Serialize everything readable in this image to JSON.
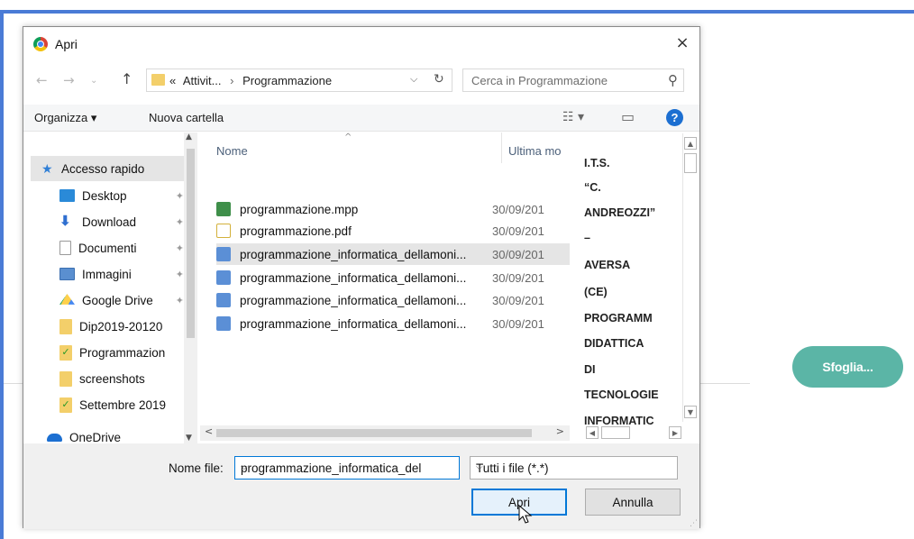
{
  "background": {
    "browse_button": "Sfoglia..."
  },
  "dialog": {
    "title": "Apri",
    "close_glyph": "×",
    "address": {
      "prefix": "«",
      "crumbs": [
        "Attivit...",
        "Programmazione"
      ],
      "dropdown_glyph": "⌵",
      "refresh_glyph": "↻"
    },
    "search_placeholder": "Cerca in Programmazione",
    "toolbar": {
      "organize": "Organizza ▾",
      "new_folder": "Nuova cartella",
      "view_glyph": "☷ ▾",
      "pane_glyph": "▭",
      "help_glyph": "?"
    },
    "nav": {
      "items": [
        {
          "label": "Accesso rapido",
          "icon": "star-icon",
          "color": "#2f7fd6"
        },
        {
          "label": "Desktop",
          "icon": "desktop-icon",
          "color": "#2a8ad8",
          "pinned": true
        },
        {
          "label": "Download",
          "icon": "download-icon",
          "color": "#2f6fd0",
          "pinned": true
        },
        {
          "label": "Documenti",
          "icon": "documents-icon",
          "color": "#c9c9c9",
          "pinned": true
        },
        {
          "label": "Immagini",
          "icon": "images-icon",
          "color": "#5a8fd0",
          "pinned": true
        },
        {
          "label": "Google Drive",
          "icon": "google-drive-icon",
          "color": "#1fa463",
          "pinned": true
        },
        {
          "label": "Dip2019-20120",
          "icon": "folder-icon",
          "color": "#f3cf6a"
        },
        {
          "label": "Programmazion",
          "icon": "folder-icon",
          "color": "#f3cf6a"
        },
        {
          "label": "screenshots",
          "icon": "folder-icon",
          "color": "#f3cf6a"
        },
        {
          "label": "Settembre 2019",
          "icon": "folder-icon",
          "color": "#f3cf6a"
        },
        {
          "label": "OneDrive",
          "icon": "cloud-icon",
          "color": "#1c6fd1"
        }
      ],
      "pin_glyph": "📌"
    },
    "files": {
      "columns": {
        "name": "Nome",
        "modified": "Ultima mo"
      },
      "rows": [
        {
          "name": "programmazione.mpp",
          "date": "30/09/201",
          "icon": "project-file-icon",
          "color": "#3f8f4a"
        },
        {
          "name": "programmazione.pdf",
          "date": "30/09/201",
          "icon": "pdf-file-icon",
          "color": "#d3b13b"
        },
        {
          "name": "programmazione_informatica_dellamoni...",
          "date": "30/09/201",
          "icon": "word-file-icon",
          "color": "#5b8fd6",
          "selected": true
        },
        {
          "name": "programmazione_informatica_dellamoni...",
          "date": "30/09/201",
          "icon": "word-file-icon",
          "color": "#5b8fd6"
        },
        {
          "name": "programmazione_informatica_dellamoni...",
          "date": "30/09/201",
          "icon": "word-file-icon",
          "color": "#5b8fd6"
        },
        {
          "name": "programmazione_informatica_dellamoni...",
          "date": "30/09/201",
          "icon": "word-file-icon",
          "color": "#5b8fd6"
        }
      ]
    },
    "preview": {
      "lines": [
        "I.T.S.",
        "“C.",
        "ANDREOZZI”",
        "–",
        "AVERSA",
        "(CE)",
        "PROGRAMM",
        "DIDATTICA",
        "DI",
        "TECNOLOGIE",
        "INFORMATIC"
      ]
    },
    "bottom": {
      "filename_label": "Nome file:",
      "filename_value": "programmazione_informatica_del",
      "filter_value": "Tutti i file (*.*)",
      "open_button": "Apri",
      "cancel_button": "Annulla"
    }
  }
}
